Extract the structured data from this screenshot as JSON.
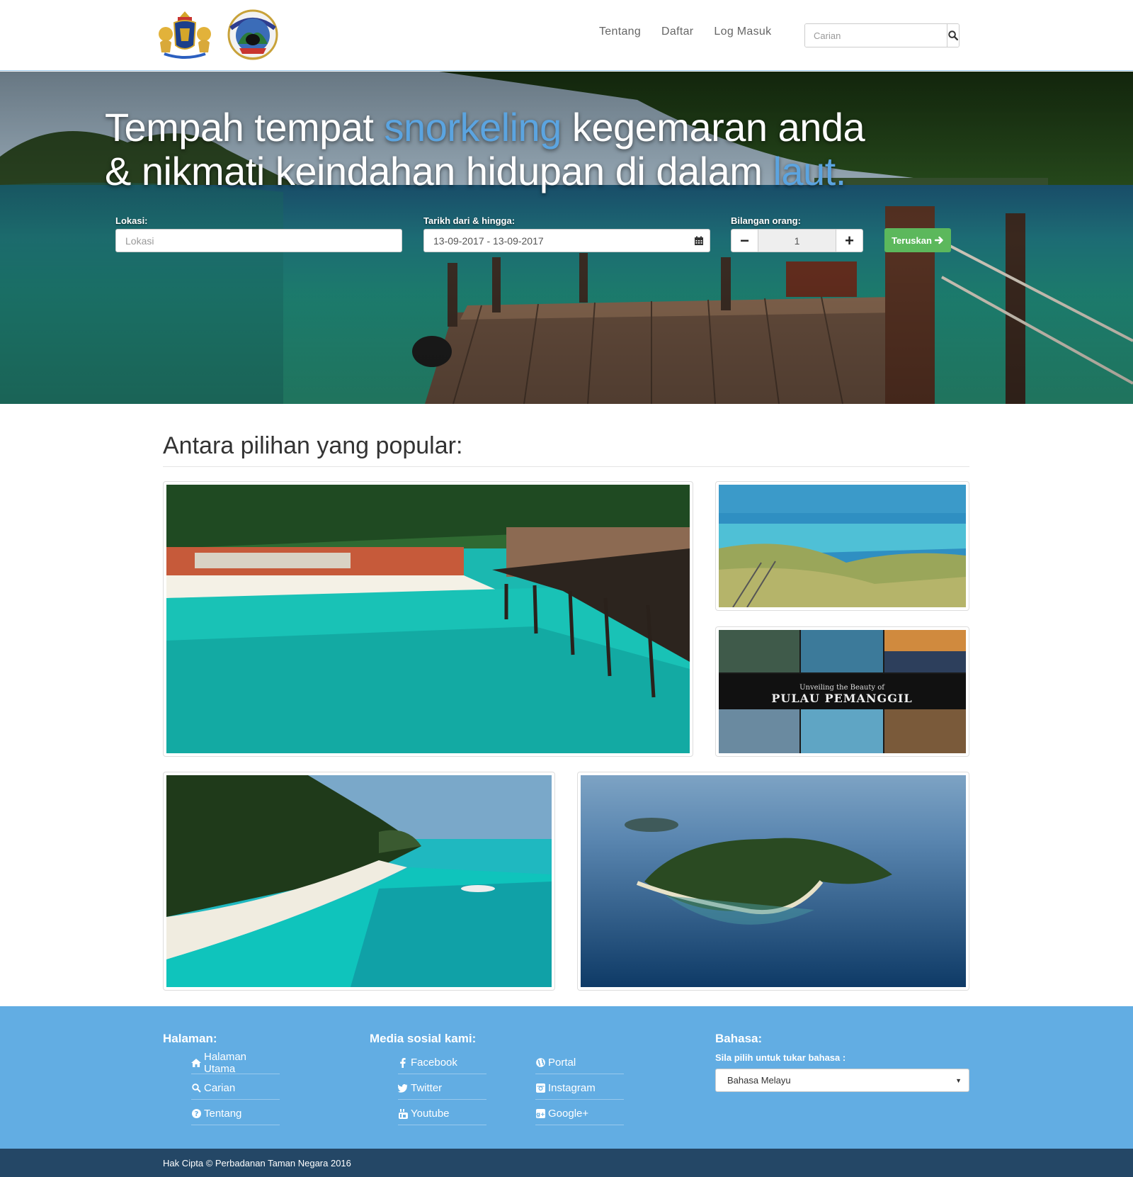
{
  "nav": {
    "links": [
      "Tentang",
      "Daftar",
      "Log Masuk"
    ],
    "search_placeholder": "Carian"
  },
  "hero": {
    "headline_line1_a": "Tempah tempat ",
    "headline_line1_b": "snorkeling",
    "headline_line1_c": " kegemaran anda",
    "headline_line2_a": "& nikmati keindahan hidupan di dalam ",
    "headline_line2_b": "laut.",
    "location_label": "Lokasi:",
    "location_placeholder": "Lokasi",
    "date_label": "Tarikh dari & hingga:",
    "date_value": "13-09-2017 - 13-09-2017",
    "people_label": "Bilangan orang:",
    "people_value": "1",
    "minus": "−",
    "plus": "+",
    "continue_label": "Teruskan"
  },
  "popular": {
    "title": "Antara pilihan yang popular:",
    "thumb2_caption_small": "Unveiling the Beauty of",
    "thumb2_caption_big": "PULAU PEMANGGIL"
  },
  "footer": {
    "pages_heading": "Halaman:",
    "pages": [
      "Halaman Utama",
      "Carian",
      "Tentang"
    ],
    "social_heading": "Media sosial kami:",
    "social_col1": [
      "Facebook",
      "Twitter",
      "Youtube"
    ],
    "social_col2": [
      "Portal",
      "Instagram",
      "Google+"
    ],
    "lang_heading": "Bahasa:",
    "lang_prompt": "Sila pilih untuk tukar bahasa :",
    "lang_selected": "Bahasa Melayu",
    "copyright": "Hak Cipta © Perbadanan Taman Negara 2016"
  },
  "colors": {
    "accent": "#5ba4e0",
    "button_green": "#5cb85c",
    "footer_blue": "#62ade3",
    "footer_dark": "#244766"
  }
}
